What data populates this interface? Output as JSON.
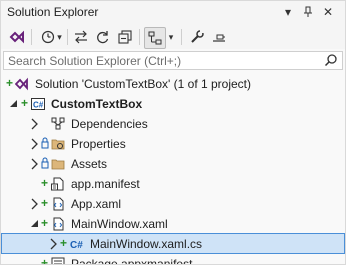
{
  "window": {
    "title": "Solution Explorer"
  },
  "title_buttons": {
    "menu": "▾",
    "pin": "⊓",
    "close": "✕"
  },
  "search": {
    "placeholder": "Search Solution Explorer (Ctrl+;)"
  },
  "tree": {
    "solution": "Solution 'CustomTextBox' (1 of 1 project)",
    "project": "CustomTextBox",
    "items": [
      {
        "label": "Dependencies"
      },
      {
        "label": "Properties"
      },
      {
        "label": "Assets"
      },
      {
        "label": "app.manifest"
      },
      {
        "label": "App.xaml"
      },
      {
        "label": "MainWindow.xaml"
      },
      {
        "label": "MainWindow.xaml.cs"
      },
      {
        "label": "Package.appxmanifest"
      }
    ]
  },
  "colors": {
    "accent": "#68217a",
    "selection": "#cfe3f7",
    "selection_border": "#4a8fd8",
    "added_green": "#2a8f2a",
    "csharp_blue": "#1a5fb4"
  }
}
